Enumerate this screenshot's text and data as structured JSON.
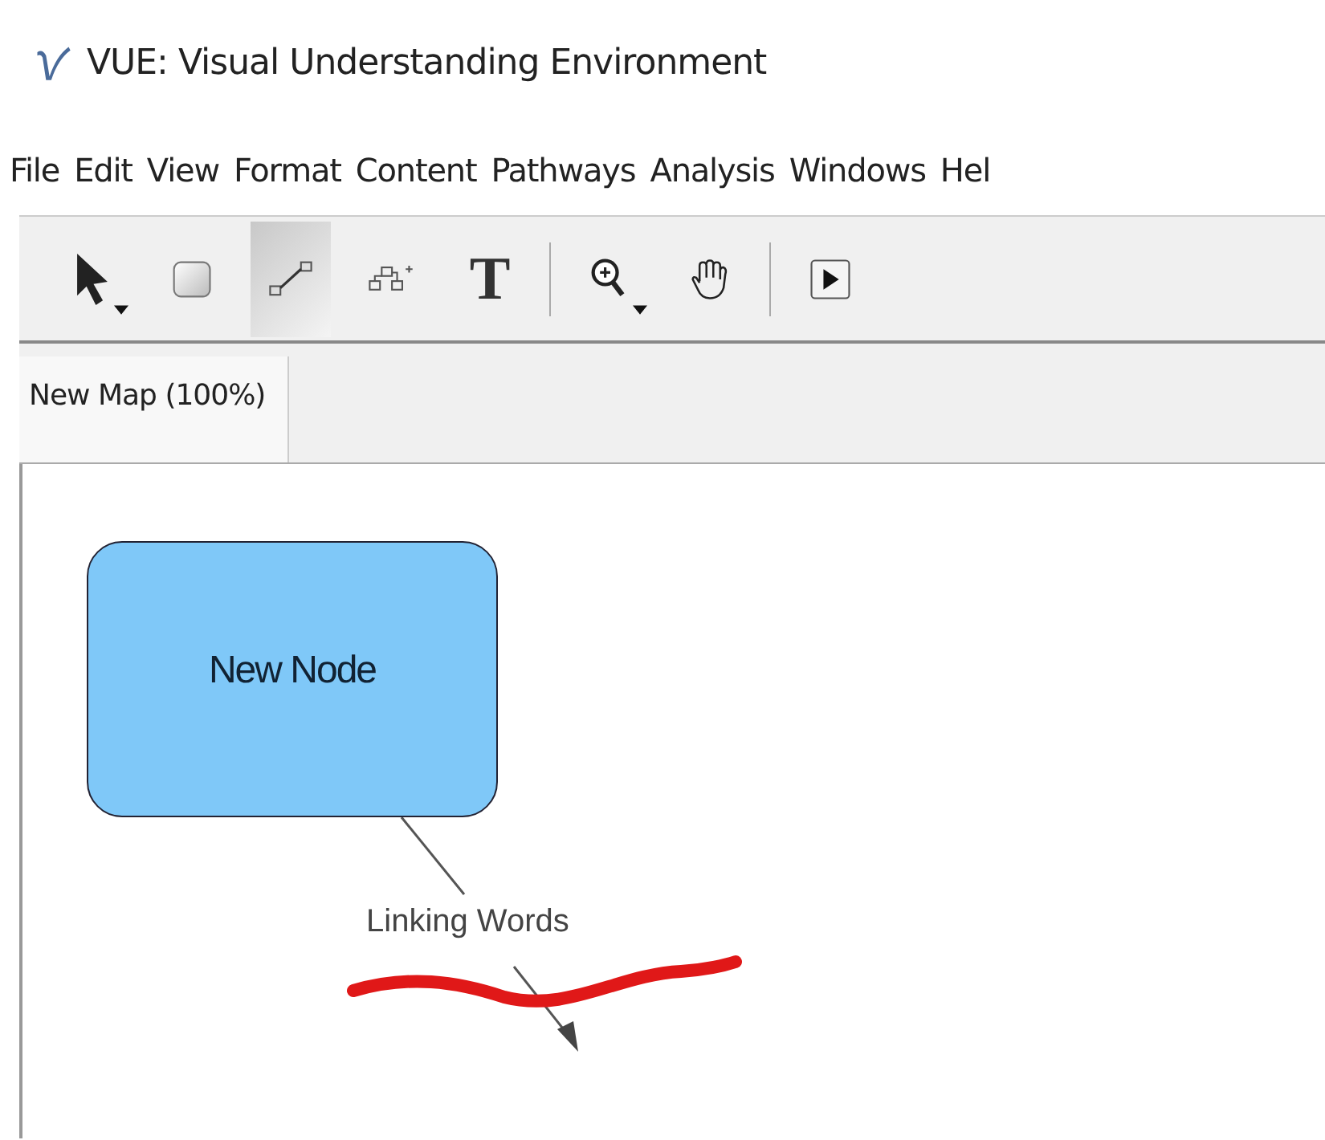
{
  "window": {
    "title": "VUE: Visual Understanding Environment"
  },
  "menu": [
    "File",
    "Edit",
    "View",
    "Format",
    "Content",
    "Pathways",
    "Analysis",
    "Windows",
    "Hel"
  ],
  "toolbar": [
    {
      "kind": "select",
      "selected": false,
      "dropdown": true
    },
    {
      "kind": "node",
      "selected": false,
      "dropdown": false
    },
    {
      "kind": "link",
      "selected": true,
      "dropdown": false
    },
    {
      "kind": "add-nodes",
      "selected": false,
      "dropdown": false
    },
    {
      "kind": "text",
      "label": "T",
      "selected": false,
      "dropdown": false
    },
    {
      "kind": "separator"
    },
    {
      "kind": "zoom",
      "selected": false,
      "dropdown": true
    },
    {
      "kind": "hand",
      "selected": false,
      "dropdown": false
    },
    {
      "kind": "separator"
    },
    {
      "kind": "play",
      "selected": false,
      "dropdown": false
    }
  ],
  "tabs": [
    {
      "label": "New Map (100%)",
      "selected": true
    }
  ],
  "map": {
    "nodes": [
      {
        "label": "New Node",
        "color": "#7fc8f8"
      }
    ],
    "links": [
      {
        "label": "Linking Words"
      }
    ],
    "annotation": {
      "kind": "scribble"
    }
  }
}
